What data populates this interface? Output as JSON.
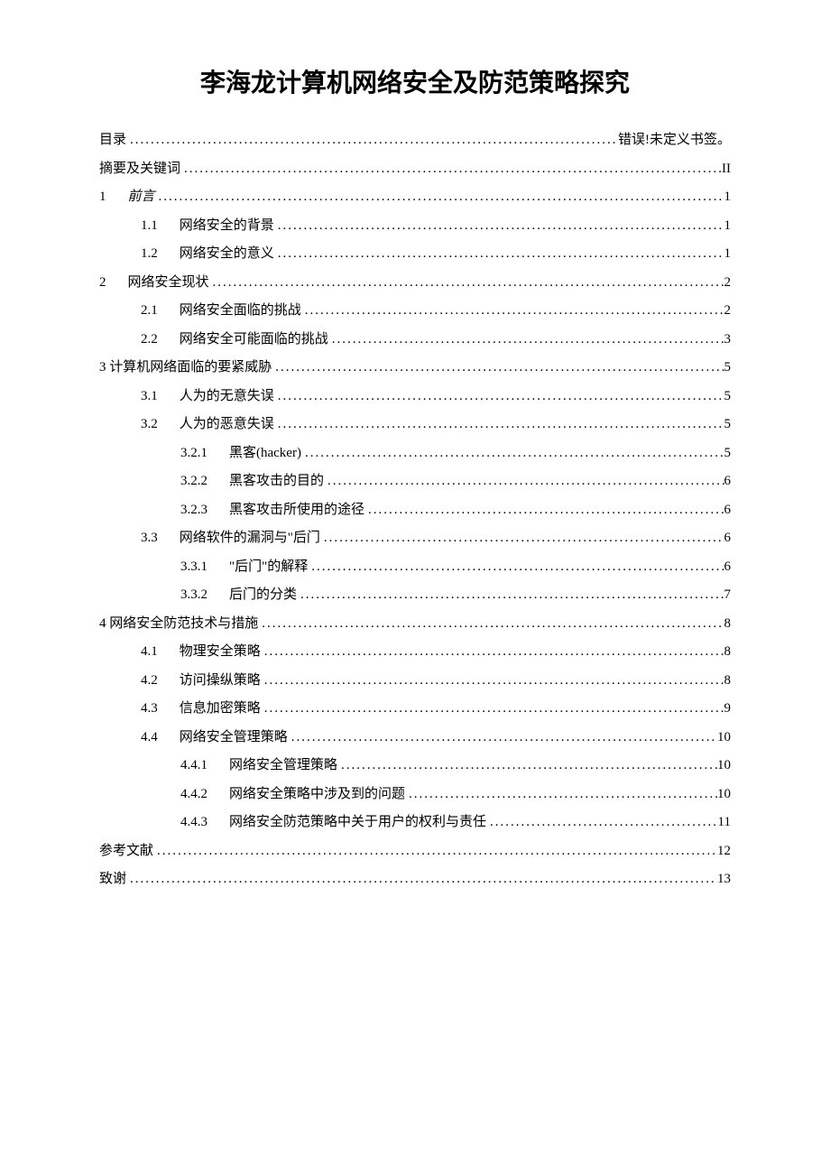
{
  "title": "李海龙计算机网络安全及防范策略探究",
  "toc": [
    {
      "level": 0,
      "num": "",
      "text": "目录",
      "page": "错误!未定义书签。",
      "italic": false
    },
    {
      "level": 0,
      "num": "",
      "text": "摘要及关键词",
      "page": "II",
      "italic": false
    },
    {
      "level": 0,
      "num": "1",
      "text": "前言",
      "page": "1",
      "italic": true
    },
    {
      "level": 1,
      "num": "1.1",
      "text": "网络安全的背景",
      "page": "1",
      "italic": false
    },
    {
      "level": 1,
      "num": "1.2",
      "text": "网络安全的意义",
      "page": "1",
      "italic": false
    },
    {
      "level": 0,
      "num": "2",
      "text": "网络安全现状",
      "page": "2",
      "italic": false
    },
    {
      "level": 1,
      "num": "2.1",
      "text": "网络安全面临的挑战",
      "page": "2",
      "italic": false
    },
    {
      "level": 1,
      "num": "2.2",
      "text": "网络安全可能面临的挑战",
      "page": "3",
      "italic": false
    },
    {
      "level": 0,
      "num": "",
      "text": "3 计算机网络面临的要紧威胁",
      "page": "5",
      "italic": false
    },
    {
      "level": 1,
      "num": "3.1",
      "text": "人为的无意失误",
      "page": "5",
      "italic": false
    },
    {
      "level": 1,
      "num": "3.2",
      "text": "人为的恶意失误",
      "page": "5",
      "italic": false
    },
    {
      "level": 2,
      "num": "3.2.1",
      "text": "黑客(hacker)",
      "page": "5",
      "italic": false
    },
    {
      "level": 2,
      "num": "3.2.2",
      "text": "黑客攻击的目的",
      "page": "6",
      "italic": false
    },
    {
      "level": 2,
      "num": "3.2.3",
      "text": "黑客攻击所使用的途径",
      "page": "6",
      "italic": false
    },
    {
      "level": 1,
      "num": "3.3",
      "text": "网络软件的漏洞与\"后门",
      "page": "6",
      "italic": false
    },
    {
      "level": 2,
      "num": "3.3.1",
      "text": "\"后门\"的解释",
      "page": "6",
      "italic": false
    },
    {
      "level": 2,
      "num": "3.3.2",
      "text": "后门的分类",
      "page": "7",
      "italic": false
    },
    {
      "level": 0,
      "num": "",
      "text": "4 网络安全防范技术与措施",
      "page": "8",
      "italic": false
    },
    {
      "level": 1,
      "num": "4.1",
      "text": "物理安全策略",
      "page": "8",
      "italic": false
    },
    {
      "level": 1,
      "num": "4.2",
      "text": "访问操纵策略",
      "page": "8",
      "italic": false
    },
    {
      "level": 1,
      "num": "4.3",
      "text": "信息加密策略",
      "page": "9",
      "italic": false
    },
    {
      "level": 1,
      "num": "4.4",
      "text": "网络安全管理策略",
      "page": "10",
      "italic": false
    },
    {
      "level": 2,
      "num": "4.4.1",
      "text": "网络安全管理策略",
      "page": "10",
      "italic": false
    },
    {
      "level": 2,
      "num": "4.4.2",
      "text": "网络安全策略中涉及到的问题",
      "page": "10",
      "italic": false
    },
    {
      "level": 2,
      "num": "4.4.3",
      "text": "网络安全防范策略中关于用户的权利与责任",
      "page": "11",
      "italic": false
    },
    {
      "level": 0,
      "num": "",
      "text": "参考文献",
      "page": "12",
      "italic": false
    },
    {
      "level": 0,
      "num": "",
      "text": "致谢",
      "page": "13",
      "italic": false
    }
  ]
}
